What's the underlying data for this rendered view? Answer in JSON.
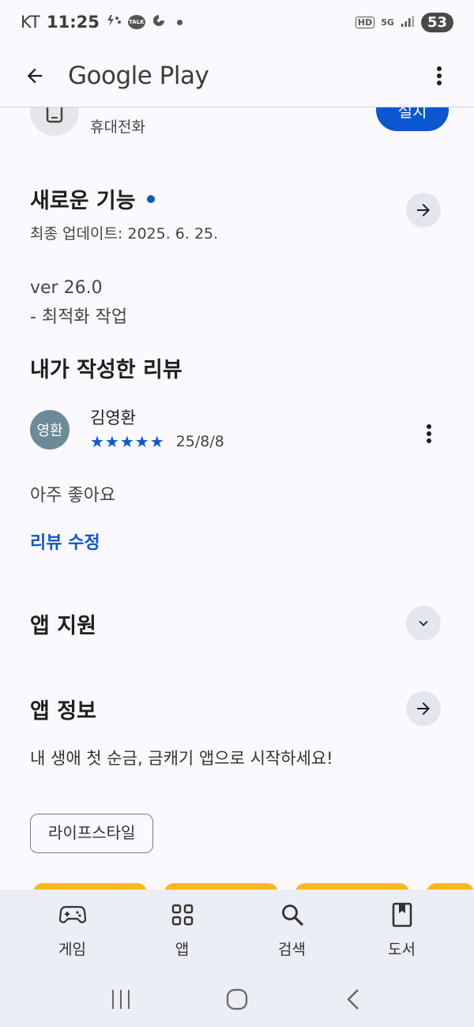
{
  "status_bar": {
    "carrier": "KT",
    "time": "11:25",
    "talk_label": "TALK",
    "hd": "HD",
    "network": "5G",
    "battery": "53"
  },
  "app_bar": {
    "title": "Google Play"
  },
  "device": {
    "label": "휴대전화",
    "install_label": "설치"
  },
  "whats_new": {
    "title": "새로운 기능",
    "updated": "최종 업데이트: 2025. 6. 25.",
    "notes": [
      "ver 26.0",
      "- 최적화 작업"
    ]
  },
  "my_review": {
    "title": "내가 작성한 리뷰",
    "avatar_text": "영환",
    "name": "김영환",
    "stars": "★★★★★",
    "rating": 5,
    "date": "25/8/8",
    "text": "아주 좋아요",
    "edit_label": "리뷰 수정"
  },
  "app_support": {
    "title": "앱 지원"
  },
  "app_info": {
    "title": "앱 정보",
    "description": "내 생애 첫 순금, 금캐기 앱으로 시작하세요!",
    "chip": "라이프스타일"
  },
  "bottom_nav": {
    "items": [
      {
        "label": "게임",
        "icon": "gamepad-icon"
      },
      {
        "label": "앱",
        "icon": "apps-grid-icon"
      },
      {
        "label": "검색",
        "icon": "search-icon"
      },
      {
        "label": "도서",
        "icon": "book-icon"
      }
    ]
  },
  "colors": {
    "accent": "#0b57d0",
    "background": "#fbf9fd",
    "nav_background": "#eceef5"
  }
}
